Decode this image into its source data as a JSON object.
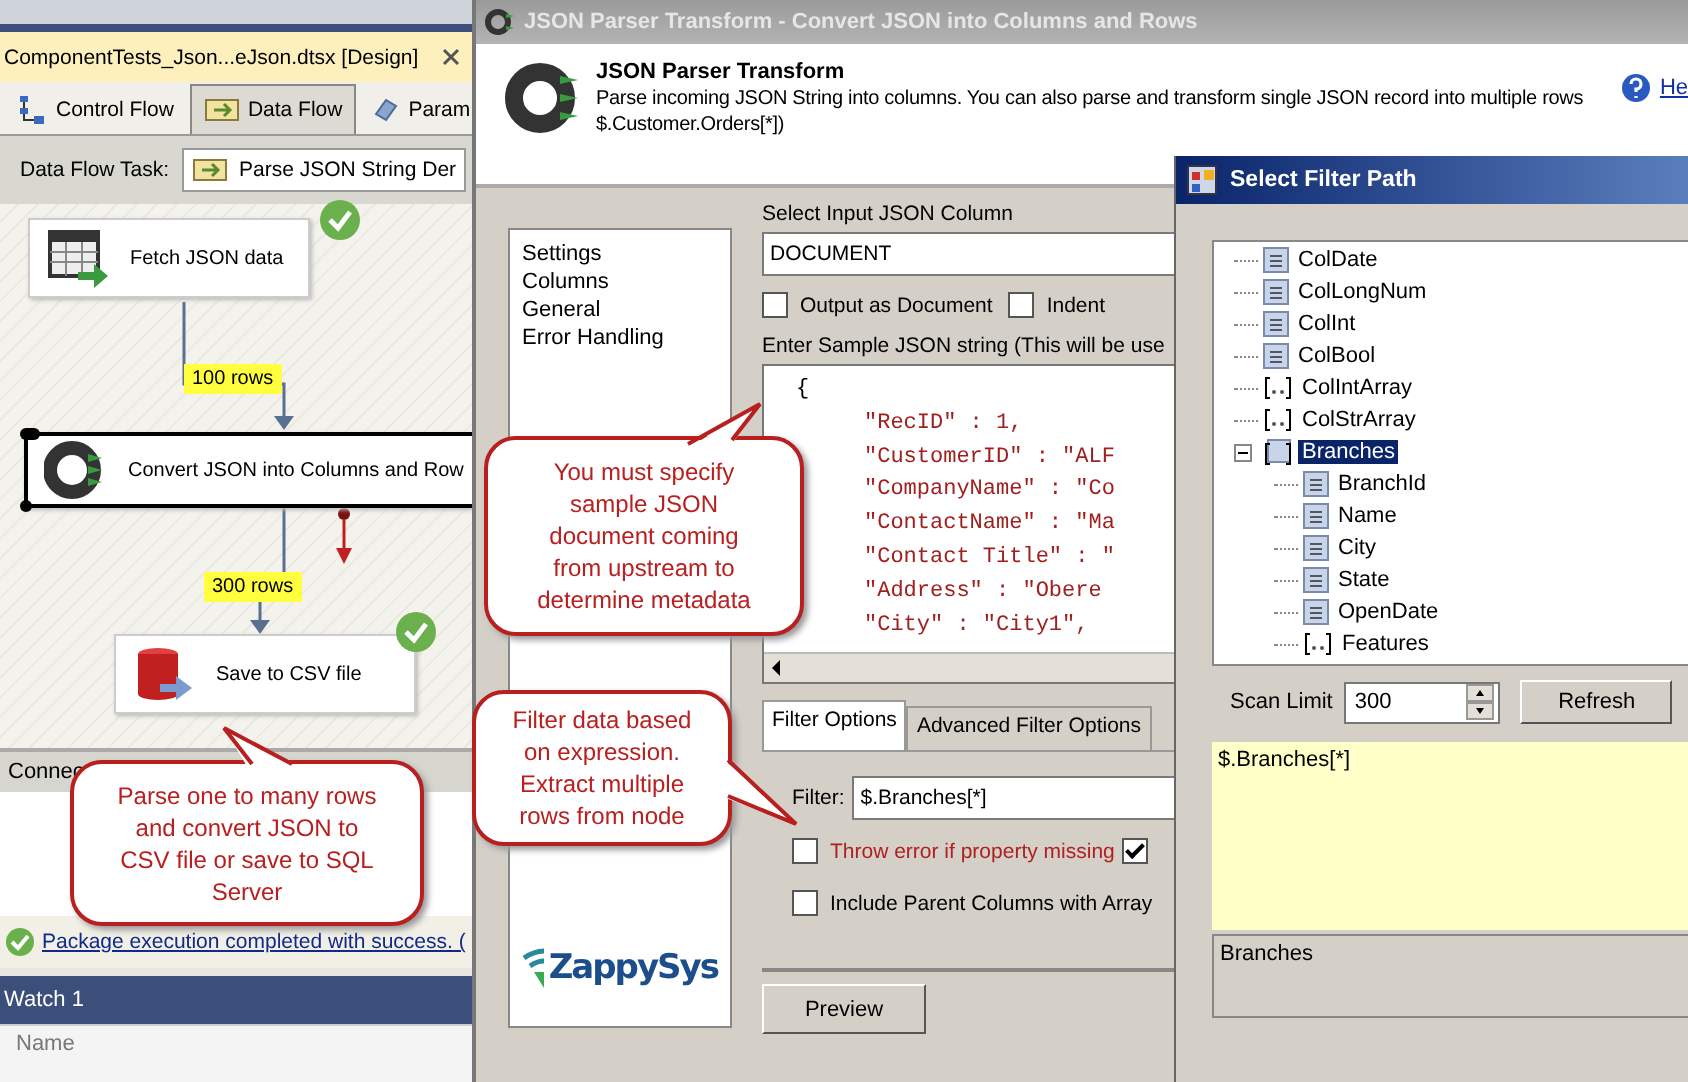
{
  "ide": {
    "document_tab": "ComponentTests_Json...eJson.dtsx [Design]",
    "designer_tabs": [
      {
        "label": "Control Flow",
        "selected": false
      },
      {
        "label": "Data Flow",
        "selected": true
      },
      {
        "label": "Param",
        "selected": false
      }
    ],
    "task_label": "Data Flow Task:",
    "task_value": "Parse JSON String Der",
    "nodes": [
      {
        "label": "Fetch JSON data",
        "kind": "source",
        "succeeded": true,
        "selected": false
      },
      {
        "label": "Convert JSON into Columns and Row",
        "kind": "transform",
        "succeeded": false,
        "selected": true
      },
      {
        "label": "Save to CSV file",
        "kind": "destination",
        "succeeded": true,
        "selected": false
      }
    ],
    "paths": [
      {
        "label": "100 rows"
      },
      {
        "label": "300 rows"
      }
    ],
    "bottom_tab": "Connec",
    "status": "Package execution completed with success. (",
    "watch_title": "Watch 1",
    "watch_column": "Name"
  },
  "parser_dialog": {
    "title": "JSON Parser Transform - Convert JSON into Columns and Rows",
    "heading": "JSON Parser Transform",
    "description": [
      "Parse incoming JSON String into columns. You can also parse and transform single JSON record into multiple rows",
      "$.Customer.Orders[*])"
    ],
    "help_link": "He",
    "nav": [
      {
        "label": "Settings"
      },
      {
        "label": "Columns"
      },
      {
        "label": "General"
      },
      {
        "label": "Error Handling"
      }
    ],
    "brand": "ZappySys",
    "input_label": "Select Input JSON Column",
    "input_value": "DOCUMENT",
    "options": [
      {
        "label": "Output as Document",
        "checked": false
      },
      {
        "label": "Indent",
        "checked": false
      }
    ],
    "sample_label": "Enter Sample JSON string (This will be use",
    "sample_lines": [
      "{",
      "\"RecID\" : 1,",
      "\"CustomerID\" : \"ALF",
      "\"CompanyName\" : \"Co",
      "\"ContactName\" : \"Ma",
      "\"Contact Title\" : \"",
      "\"Address\" : \"Obere",
      "\"City\" : \"City1\","
    ],
    "filter_tabs": [
      {
        "label": "Filter Options",
        "selected": true
      },
      {
        "label": "Advanced Filter Options",
        "selected": false
      }
    ],
    "filter_label": "Filter:",
    "filter_value": "$.Branches[*]",
    "filter_checks": [
      {
        "label": "Throw error if property missing",
        "checked": false,
        "kind": "warning"
      },
      {
        "checked": true,
        "kind": "plain"
      },
      {
        "label": "Include Parent Columns with Array",
        "checked": false,
        "kind": "plain"
      }
    ],
    "preview_button": "Preview"
  },
  "filter_dialog": {
    "title": "Select Filter Path",
    "tree": [
      {
        "label": "ColDate",
        "kind": "field",
        "selected": false
      },
      {
        "label": "ColLongNum",
        "kind": "field",
        "selected": false
      },
      {
        "label": "ColInt",
        "kind": "field",
        "selected": false
      },
      {
        "label": "ColBool",
        "kind": "field",
        "selected": false
      },
      {
        "label": "ColIntArray",
        "kind": "array",
        "selected": false
      },
      {
        "label": "ColStrArray",
        "kind": "array",
        "selected": false
      },
      {
        "label": "Branches",
        "kind": "object",
        "selected": true,
        "expanded": true,
        "children": [
          {
            "label": "BranchId",
            "kind": "field",
            "selected": false
          },
          {
            "label": "Name",
            "kind": "field",
            "selected": false
          },
          {
            "label": "City",
            "kind": "field",
            "selected": false
          },
          {
            "label": "State",
            "kind": "field",
            "selected": false
          },
          {
            "label": "OpenDate",
            "kind": "field",
            "selected": false
          },
          {
            "label": "Features",
            "kind": "array",
            "selected": false
          }
        ]
      }
    ],
    "scan_label": "Scan Limit",
    "scan_value": "300",
    "refresh_button": "Refresh",
    "path_value": "$.Branches[*]",
    "node_name": "Branches"
  },
  "callouts": [
    "You must specify sample JSON document coming from upstream to determine metadata",
    "Filter data based on expression. Extract multiple rows from node",
    "Parse one to many rows and convert JSON to CSV file or save to SQL Server"
  ]
}
